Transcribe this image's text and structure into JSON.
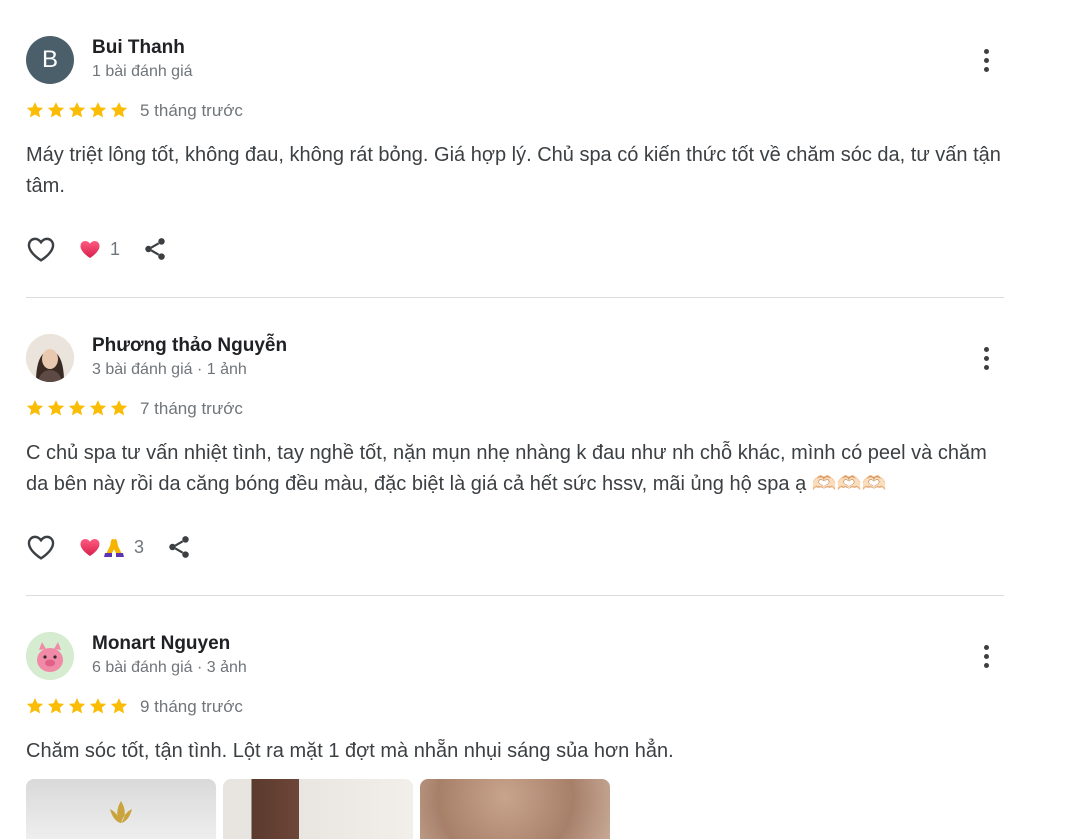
{
  "colors": {
    "star": "#fbbc04",
    "heart": "#e8335f",
    "accent_gray": "#70757a"
  },
  "reviews": [
    {
      "avatar_letter": "B",
      "name": "Bui Thanh",
      "meta": "1 bài đánh giá",
      "rating": 5,
      "time": "5 tháng trước",
      "text": "Máy triệt lông tốt, không đau, không rát bỏng. Giá hợp lý. Chủ spa có kiến thức tốt về chăm sóc da, tư vấn tận tâm.",
      "reaction_count": "1",
      "reactions": [
        "heart-emoji"
      ]
    },
    {
      "avatar_letter": "",
      "name": "Phương thảo Nguyễn",
      "meta": "3 bài đánh giá · 1 ảnh",
      "rating": 5,
      "time": "7 tháng trước",
      "text": "C chủ spa tư vấn nhiệt tình, tay nghề tốt, nặn mụn nhẹ nhàng k đau như nh chỗ khác, mình có peel và chăm da bên này rồi da căng bóng đều màu, đặc biệt là giá cả hết sức hssv, mãi ủng hộ spa ạ 🫶🏻🫶🏻🫶🏻",
      "reaction_count": "3",
      "reactions": [
        "heart-emoji",
        "pray-emoji"
      ]
    },
    {
      "avatar_letter": "",
      "name": "Monart Nguyen",
      "meta": "6 bài đánh giá · 3 ảnh",
      "rating": 5,
      "time": "9 tháng trước",
      "text": "Chăm sóc tốt, tận tình. Lột ra mặt 1 đợt mà nhẵn nhụi sáng sủa hơn hẳn.",
      "photos": [
        "photo-1",
        "photo-2",
        "photo-3"
      ]
    }
  ],
  "icons": {
    "more": "more-vert-icon",
    "star": "star-icon",
    "like": "heart-outline-icon",
    "share": "share-icon"
  }
}
